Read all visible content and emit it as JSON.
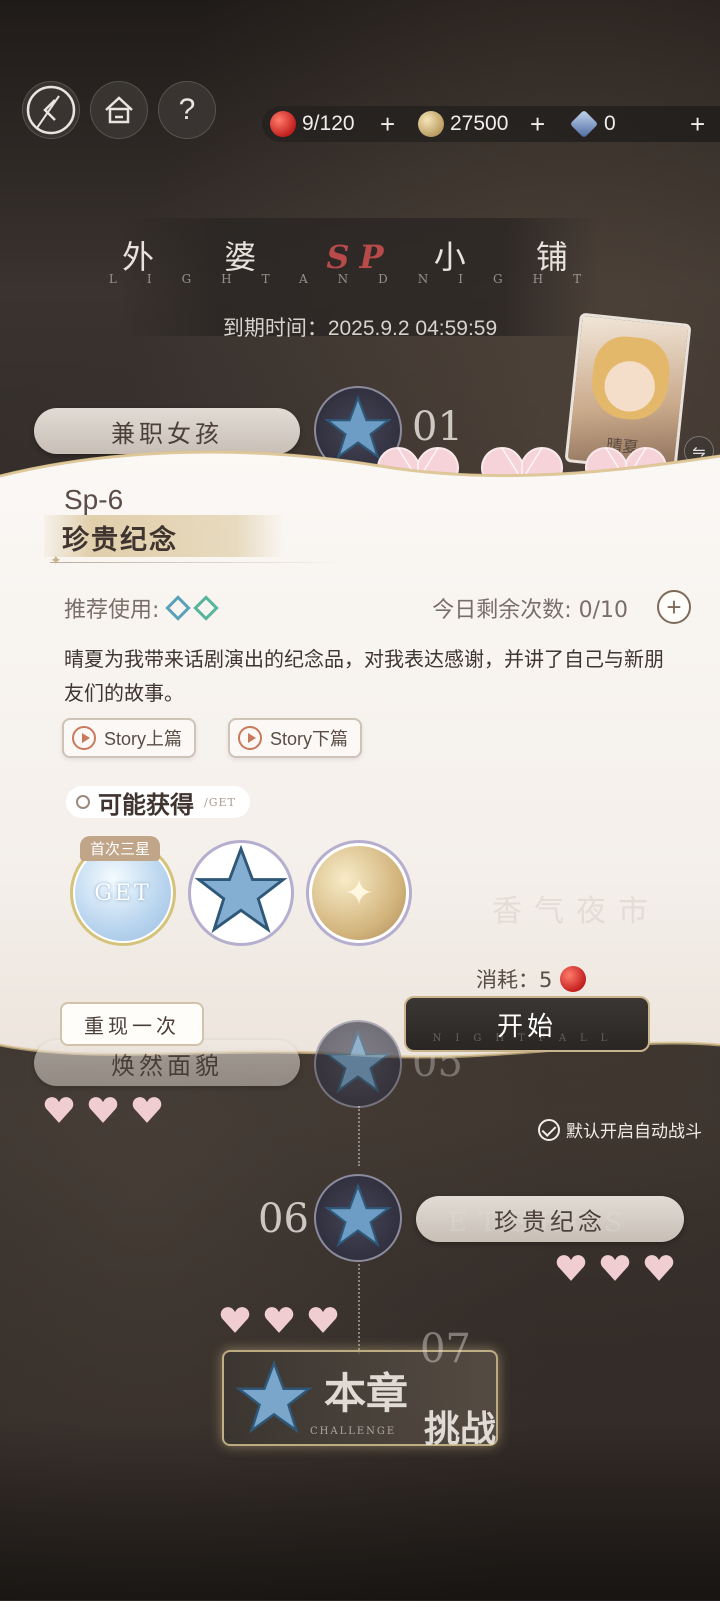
{
  "header": {
    "back_icon": "back-arrow-icon",
    "home_icon": "home-icon",
    "help_label": "?"
  },
  "resources": {
    "stamina": "9/120",
    "coins": "27500",
    "gems": "0",
    "plus": "+"
  },
  "shop": {
    "title_left": "外 婆",
    "title_sp": "SP",
    "title_right": "小 铺",
    "subtitle": "LIGHTANDNIGHT",
    "expire": "到期时间：2025.9.2 04:59:59"
  },
  "character": {
    "name": "晴夏"
  },
  "map": {
    "stage1_label": "兼职女孩",
    "stage1_num": "01",
    "stage5_label": "焕然面貌",
    "stage5_num": "05",
    "stage6_label": "珍贵纪念",
    "stage6_num": "06",
    "stage7_num": "07",
    "challenge_big": "本章",
    "challenge_big2": "挑战",
    "challenge_en": "CHALLENGE",
    "other_label": "香气夜市",
    "deco_en": "ETEROS"
  },
  "detail": {
    "code": "Sp-6",
    "name": "珍贵纪念",
    "recommend_label": "推荐使用:",
    "remain_label": "今日剩余次数: 0/10",
    "remain_plus": "+",
    "description": "晴夏为我带来话剧演出的纪念品，对我表达感谢，并讲了自己与新朋友们的故事。",
    "story_prev": "Story上篇",
    "story_next": "Story下篇",
    "get_title": "可能获得",
    "get_tag": "/GET",
    "first_clear_badge": "首次三星",
    "reward_get_text": "GET",
    "cost_label": "消耗：5",
    "replay_label": "重现一次",
    "start_label": "开始",
    "start_sub": "NIGHTFALL",
    "auto_battle": "默认开启自动战斗"
  },
  "colors": {
    "accent_gold": "#c9b48d",
    "panel_bg": "#fbf8f5",
    "button_dark": "#2a2624",
    "sp_red": "#b84a4a"
  }
}
